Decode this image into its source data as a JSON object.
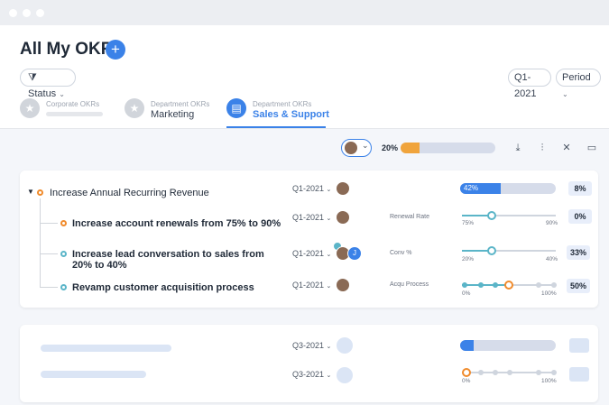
{
  "page": {
    "title": "All My OKRs",
    "add_label": "+"
  },
  "filters": {
    "status_label": "Status",
    "quarter_label": "Q1-2021",
    "period_label": "Period"
  },
  "tabs": [
    {
      "small": "Corporate OKRs",
      "big": "",
      "active": false
    },
    {
      "small": "Department OKRs",
      "big": "Marketing",
      "active": false
    },
    {
      "small": "Department OKRs",
      "big": "Sales & Support",
      "active": true
    }
  ],
  "toolbar": {
    "overall_percent": "20%",
    "overall_progress": 0.2
  },
  "colors": {
    "accent": "#3b82e8",
    "orange": "#f08b2c",
    "teal": "#5bb5c8",
    "track": "#d6dcea"
  },
  "objective": {
    "title": "Increase Annual Recurring Revenue",
    "quarter": "Q1-2021",
    "progress_label": "42%",
    "progress": 0.42,
    "percent_badge": "8%"
  },
  "key_results": [
    {
      "title": "Increase account renewals from 75% to 90%",
      "quarter": "Q1-2021",
      "metric": "Renewal Rate",
      "min": "75%",
      "max": "90%",
      "level": 0.32,
      "badge": "0%"
    },
    {
      "title_line1": "Increase lead conversation to sales from",
      "title_line2": "20% to 40%",
      "quarter": "Q1-2021",
      "metric": "Conv %",
      "min": "20%",
      "max": "40%",
      "level": 0.32,
      "badge": "33%",
      "avatar_initial": "J"
    },
    {
      "title": "Revamp customer acquisition process",
      "quarter": "Q1-2021",
      "metric": "Acqu Process",
      "min": "0%",
      "max": "100%",
      "level": 0.5,
      "badge": "50%"
    }
  ],
  "placeholder_rows": [
    {
      "quarter": "Q3-2021",
      "min": "",
      "max": "",
      "progress": 0.14
    },
    {
      "quarter": "Q3-2021",
      "min": "0%",
      "max": "100%"
    }
  ]
}
